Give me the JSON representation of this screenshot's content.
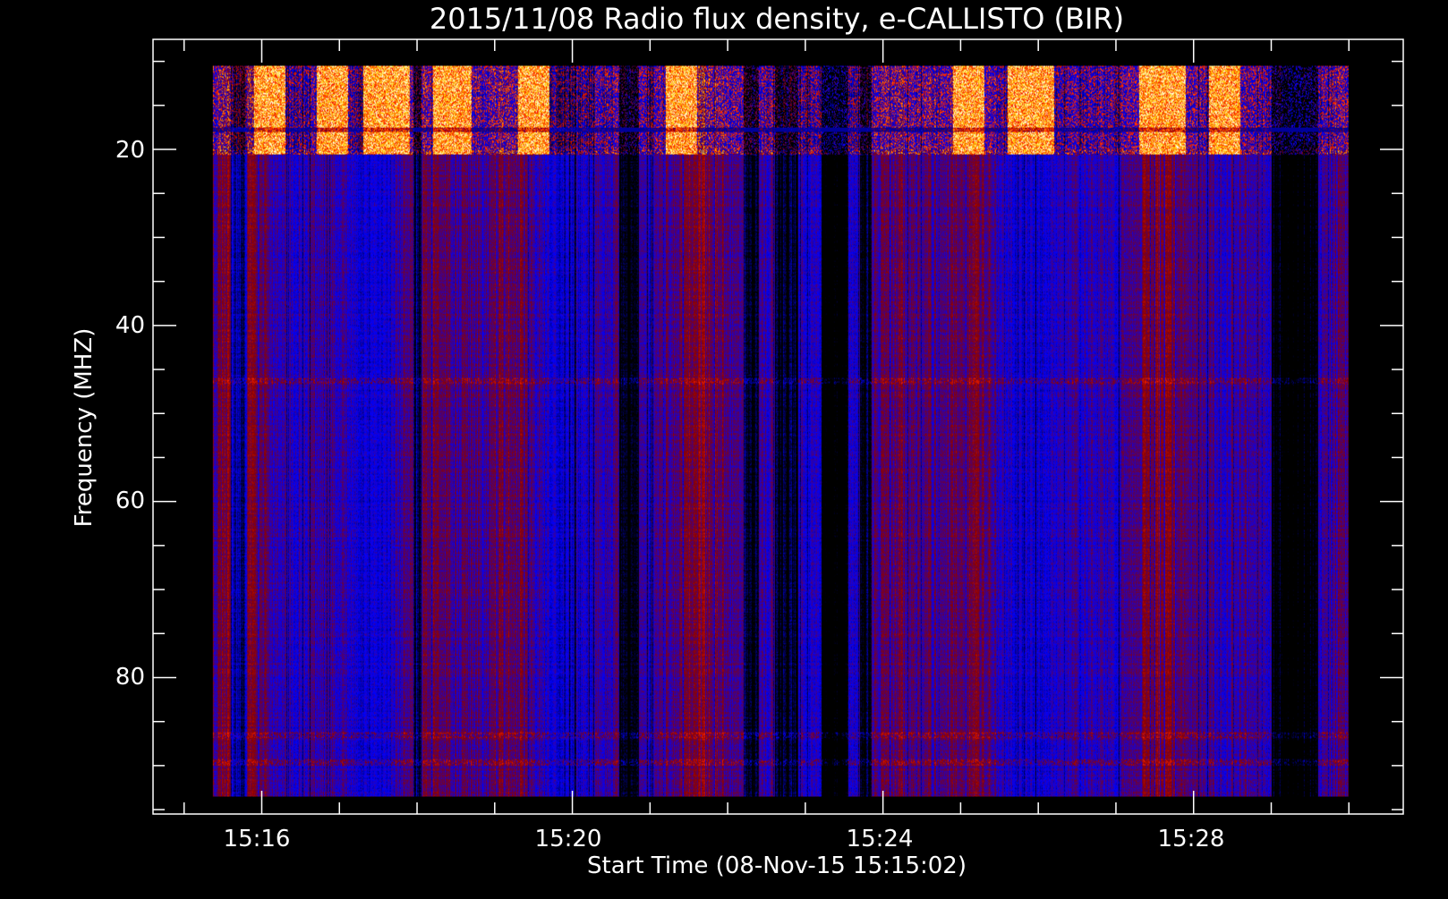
{
  "chart_data": {
    "type": "heatmap",
    "title": "2015/11/08  Radio flux density, e-CALLISTO (BIR)",
    "xlabel": "Start Time (08-Nov-15 15:15:02)",
    "ylabel": "Frequency (MHZ)",
    "x_ticks": [
      "15:16",
      "15:20",
      "15:24",
      "15:28"
    ],
    "y_ticks": [
      "20",
      "40",
      "60",
      "80"
    ],
    "x_range_minutes": [
      14.6,
      30.7
    ],
    "data_start_minutes": 15.37,
    "data_end_minutes": 30.0,
    "y_range_mhz": [
      7.5,
      95.5
    ],
    "data_freq_mhz": [
      10.5,
      93.5
    ],
    "colormap": [
      "#000000",
      "#0000ff",
      "#8b0000",
      "#ff2200",
      "#ffcc00",
      "#ffffff"
    ],
    "bright_time_bands_minutes": [
      [
        15.9,
        16.3
      ],
      [
        16.7,
        17.1
      ],
      [
        17.3,
        17.9
      ],
      [
        18.2,
        18.7
      ],
      [
        19.3,
        19.7
      ],
      [
        21.2,
        21.6
      ],
      [
        24.9,
        25.3
      ],
      [
        25.6,
        26.2
      ],
      [
        27.3,
        27.9
      ],
      [
        28.2,
        28.6
      ]
    ],
    "dark_time_bands_minutes": [
      [
        15.6,
        15.8
      ],
      [
        17.95,
        18.05
      ],
      [
        20.6,
        20.85
      ],
      [
        22.2,
        22.4
      ],
      [
        22.6,
        22.9
      ],
      [
        23.2,
        23.55
      ],
      [
        23.7,
        23.85
      ],
      [
        29.0,
        29.6
      ]
    ],
    "horizontal_lines_mhz": [
      20.3,
      46.3,
      86.5,
      89.5
    ],
    "grid": false,
    "legend": "none"
  }
}
